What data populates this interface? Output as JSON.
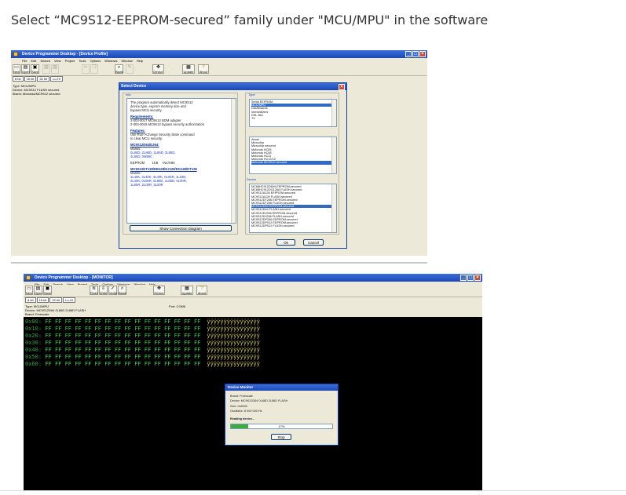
{
  "caption": "Select “MC9S12-EEPROM-secured” family under \"MCU/MPU\" in the software",
  "window1": {
    "title": "Device Programmer Desktop - [Device Profile]",
    "menus": [
      "File",
      "Edit",
      "Search",
      "View",
      "Project",
      "Tools",
      "Options",
      "Windows",
      "Window",
      "Help"
    ],
    "toolbar": [
      "New",
      "Open",
      "Save",
      "Blank",
      "Device",
      "Update",
      "About"
    ],
    "bit_tabs": [
      "8 bit",
      "16 bit",
      "32 bit",
      "Lo-Hi"
    ],
    "info": [
      "Type: MCU/MPU",
      "Device: MC9S12 FLASH secured",
      "Brand: Motorola/MC9S12 secured"
    ]
  },
  "dialog": {
    "title": "Select Device",
    "info_label": "Info",
    "type_label": "Type",
    "device_label": "Device",
    "info_text": [
      "The program automatically detect MC9S12",
      "device type, eeprom memory size and",
      "bypass MCU security."
    ],
    "requirements_heading": "Requirements:",
    "requirements": [
      "1-003-0017 MC9S12 BDM adapter",
      "2-003-0018 MC9S12 bypass security authorization"
    ],
    "features_heading": "Features:",
    "features": [
      "Use Run->Change Security State command",
      "to clear MCU security."
    ],
    "part1_heading": "MC9S12D64/DJ64:",
    "part1_masks_label": "Masks:",
    "part1_masks": [
      "0L86D, 2L86D, 2L86D, 3L86D,",
      "4L86D, 0M89C"
    ],
    "part1_row": [
      "EEPROM",
      "1KB",
      "IN1/H86"
    ],
    "part2_heading": "MC9S12DT128/DB128/DJ128/DG128/DT128",
    "part2_masks_label": "Masks:",
    "part2_masks": [
      "1L40K, 3L40K, 4L40K, 0L94R, 1L63N,",
      "2L40K, 0L66R, 0L85D, 1L85D, 0L00R,",
      "1L85R, 2L00R, 3L00R"
    ],
    "show_diagram": "Show Connection Diagram",
    "types": [
      "Serial EEPROM",
      "MCU/MPU",
      "Dashboards",
      "Immobilizers",
      "DSL-NM",
      "TV"
    ],
    "type_selected": 1,
    "families": [
      "Atmel",
      "Microchip",
      "Microchip secured",
      "Motorola HC05",
      "Motorola HC08",
      "Motorola HC11",
      "Motorola HC12/12",
      "Motorola MC9S12 secured"
    ],
    "family_selected": 7,
    "devices": [
      "MC68HC912D60A EEPROM-secured",
      "MC68HC912DG128A FLASH-secured",
      "MC9S12A128 EEPROM-secured",
      "MC9S12A128 FLASH-secured",
      "MC9S12DT256 EEPROM-secured",
      "MC9S12DT256 FLASH-secured",
      "MC9S12D64 EEPROM-secured",
      "MC9S12D64 FLASH-secured",
      "MC9S12DJ256 EEPROM-secured",
      "MC9S12DJ256 FLASH-secured",
      "MC9S12DP256 EEPROM-secured",
      "MC9S12DP512 EEPROM-secured",
      "MC9S12DP512 FLASH-secured"
    ],
    "device_selected": 6,
    "ok": "Ok",
    "cancel": "Cancel"
  },
  "window2": {
    "title": "Device Programmer Desktop - [MONITOR]",
    "menus": [
      "File",
      "Edit",
      "Search",
      "View",
      "Project",
      "Tools",
      "Options",
      "Windows",
      "Window",
      "Help"
    ],
    "toolbar": [
      "New",
      "Open",
      "Save",
      "Read",
      "Write",
      "Verify",
      "Blank",
      "Device",
      "Update",
      "About"
    ],
    "bit_tabs": [
      "8 bit",
      "16 bit",
      "32 bit",
      "Lo-Hi"
    ],
    "info": [
      "Type: MCU/MPU",
      "Device: MC9S12D64 0L86D 2L86D FLASH",
      "Brand: Freescale"
    ],
    "port": "Port: COM6",
    "hex_rows": [
      {
        "addr": "0x00:",
        "bytes": "FF FF FF FF FF FF FF FF FF FF FF FF FF FF FF FF",
        "ascii": "ÿÿÿÿÿÿÿÿÿÿÿÿÿÿÿÿ"
      },
      {
        "addr": "0x10:",
        "bytes": "FF FF FF FF FF FF FF FF FF FF FF FF FF FF FF FF",
        "ascii": "ÿÿÿÿÿÿÿÿÿÿÿÿÿÿÿÿ"
      },
      {
        "addr": "0x20:",
        "bytes": "FF FF FF FF FF FF FF FF FF FF FF FF FF FF FF FF",
        "ascii": "ÿÿÿÿÿÿÿÿÿÿÿÿÿÿÿÿ"
      },
      {
        "addr": "0x30:",
        "bytes": "FF FF FF FF FF FF FF FF FF FF FF FF FF FF FF FF",
        "ascii": "ÿÿÿÿÿÿÿÿÿÿÿÿÿÿÿÿ"
      },
      {
        "addr": "0x40:",
        "bytes": "FF FF FF FF FF FF FF FF FF FF FF FF FF FF FF FF",
        "ascii": "ÿÿÿÿÿÿÿÿÿÿÿÿÿÿÿÿ"
      },
      {
        "addr": "0x50:",
        "bytes": "FF FF FF FF FF FF FF FF FF FF FF FF FF FF FF FF",
        "ascii": "ÿÿÿÿÿÿÿÿÿÿÿÿÿÿÿÿ"
      },
      {
        "addr": "0x60:",
        "bytes": "FF FF FF FF FF FF FF FF FF FF FF FF FF FF FF FF",
        "ascii": "ÿÿÿÿÿÿÿÿÿÿÿÿÿÿÿÿ"
      }
    ]
  },
  "monitor": {
    "title": "Device Monitor",
    "lines": [
      "Brand: Freescale",
      "Device: MC9S12D64 0L86D 2L86D FLASH",
      "Size: 0x8000",
      "Oscillator: 8 000 000 Hz"
    ],
    "status": "Reading device...",
    "progress_percent": 17,
    "progress_label": "17%",
    "stop": "Stop"
  }
}
